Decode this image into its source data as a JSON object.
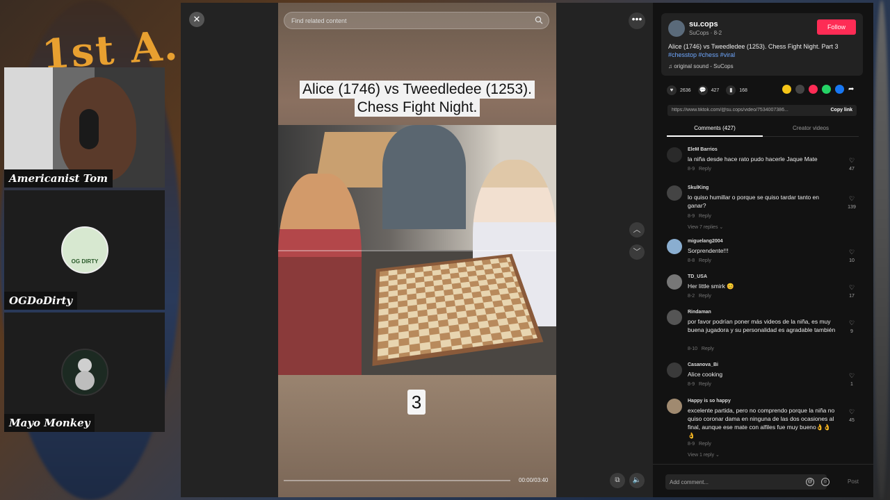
{
  "background": {
    "overlay_text": "1st A."
  },
  "cams": [
    {
      "name": "Americanist Tom"
    },
    {
      "name": "OGDoDirty",
      "avatar_text": "OG DIRTY"
    },
    {
      "name": "Mayo Monkey"
    }
  ],
  "player": {
    "search_placeholder": "Find related content",
    "video_title_line1": "Alice (1746) vs Tweedledee (1253).",
    "video_title_line2": "Chess Fight Night.",
    "step_number": "3",
    "time": "00:00/03:40",
    "progress_fraction": 0.0
  },
  "post": {
    "author": "su.cops",
    "author_sub": "SuCops · 8-2",
    "follow_label": "Follow",
    "caption": "Alice (1746) vs Tweedledee (1253). Chess Fight Night. Part 3",
    "tags": [
      "#chesstop",
      "#chess",
      "#viral"
    ],
    "sound": "original sound - SuCops",
    "likes": "2636",
    "comments_count": "427",
    "saves": "168",
    "link": "https://www.tiktok.com/@su.cops/video/7534007386...",
    "copy_link_label": "Copy link"
  },
  "tabs": {
    "comments": "Comments (427)",
    "creator": "Creator videos"
  },
  "comments": [
    {
      "user": "EleM Barrios",
      "text": "la niña desde hace rato pudo hacerle Jaque Mate",
      "date": "8-9",
      "reply": "Reply",
      "likes": "47",
      "replies": ""
    },
    {
      "user": "SkulKing",
      "text": "lo quiso humillar o porque se quiso tardar tanto en ganar?",
      "date": "8-9",
      "reply": "Reply",
      "likes": "139",
      "replies": "View 7 replies ⌄"
    },
    {
      "user": "miguelang2004",
      "text": "Sorprendente!!!",
      "date": "8-8",
      "reply": "Reply",
      "likes": "10",
      "replies": ""
    },
    {
      "user": "TD_USA",
      "text": "Her little smirk 😊",
      "date": "8-2",
      "reply": "Reply",
      "likes": "17",
      "replies": ""
    },
    {
      "user": "Rindaman",
      "text": "por favor podrían poner más videos de la niña, es muy buena jugadora y su personalidad es agradable también",
      "date": "8-10",
      "reply": "Reply",
      "likes": "9",
      "replies": ""
    },
    {
      "user": "Casanova_Bi",
      "text": "Alice cooking",
      "date": "8-9",
      "reply": "Reply",
      "likes": "1",
      "replies": ""
    },
    {
      "user": "Happy is so happy",
      "text": "excelente partida, pero no comprendo porque la niña no quiso coronar dama en ninguna de las dos ocasiones al final, aunque ese mate con alfiles fue muy bueno👌👌👌",
      "date": "8-9",
      "reply": "Reply",
      "likes": "45",
      "replies": "View 1 reply ⌄"
    }
  ],
  "footer": {
    "comment_placeholder": "Add comment...",
    "post_label": "Post"
  },
  "colors": {
    "accent": "#fe2c55",
    "tag": "#6fa8ff"
  }
}
